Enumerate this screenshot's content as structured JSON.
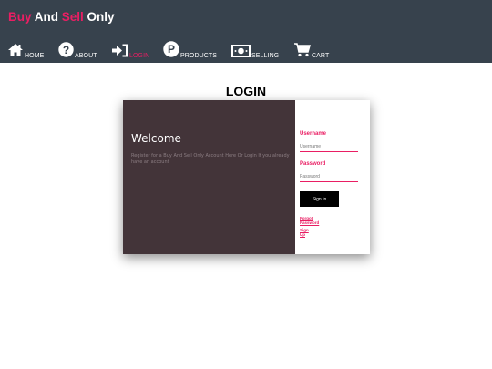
{
  "brand": {
    "part1": "Buy",
    "part2": " And ",
    "part3": "Sell",
    "part4": " Only",
    "accent": "#e91e63"
  },
  "nav": [
    {
      "label": "HOME",
      "icon": "home-icon"
    },
    {
      "label": "ABOUT",
      "icon": "question-icon"
    },
    {
      "label": "LOGIN",
      "icon": "sign-in-icon",
      "active": true
    },
    {
      "label": "PRODUCTS",
      "icon": "products-p-icon"
    },
    {
      "label": "SELLING",
      "icon": "money-icon"
    },
    {
      "label": "CART",
      "icon": "cart-icon"
    }
  ],
  "page_title": "LOGIN",
  "welcome": {
    "title": "Welcome",
    "description": "Register for a Buy And Sell Only Account Here Or Login If you already have an account"
  },
  "form": {
    "username_label": "Username",
    "username_placeholder": "Username",
    "password_label": "Password",
    "password_placeholder": "Password",
    "signin_label": "Sign In",
    "forgot_line1": "Forgot",
    "forgot_line2": "Password",
    "signup_line1": "Sign",
    "signup_line2": "Up"
  },
  "colors": {
    "header_bg": "#37424d",
    "panel_bg": "#433439",
    "accent": "#e91e63"
  }
}
